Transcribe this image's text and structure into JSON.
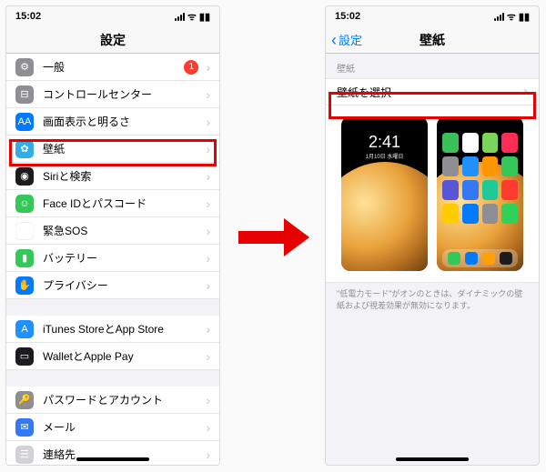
{
  "status": {
    "time": "15:02"
  },
  "left": {
    "title": "設定",
    "groups": [
      [
        {
          "id": "general",
          "label": "一般",
          "color": "c-gray",
          "glyph": "⚙",
          "badge": "1"
        },
        {
          "id": "control",
          "label": "コントロールセンター",
          "color": "c-gray2",
          "glyph": "⊟"
        },
        {
          "id": "display",
          "label": "画面表示と明るさ",
          "color": "c-blue",
          "glyph": "AA"
        },
        {
          "id": "wallpaper",
          "label": "壁紙",
          "color": "c-cyan",
          "glyph": "✿"
        },
        {
          "id": "siri",
          "label": "Siriと検索",
          "color": "c-black",
          "glyph": "◉"
        },
        {
          "id": "faceid",
          "label": "Face IDとパスコード",
          "color": "c-green",
          "glyph": "☺"
        },
        {
          "id": "sos",
          "label": "緊急SOS",
          "color": "c-sos",
          "glyph": "SOS"
        },
        {
          "id": "battery",
          "label": "バッテリー",
          "color": "c-green2",
          "glyph": "▮"
        },
        {
          "id": "privacy",
          "label": "プライバシー",
          "color": "c-blue",
          "glyph": "✋"
        }
      ],
      [
        {
          "id": "appstore",
          "label": "iTunes StoreとApp Store",
          "color": "c-appstore",
          "glyph": "A"
        },
        {
          "id": "wallet",
          "label": "WalletとApple Pay",
          "color": "c-wallet",
          "glyph": "▭"
        }
      ],
      [
        {
          "id": "accounts",
          "label": "パスワードとアカウント",
          "color": "c-key",
          "glyph": "🔑"
        },
        {
          "id": "mail",
          "label": "メール",
          "color": "c-mail",
          "glyph": "✉"
        },
        {
          "id": "contacts",
          "label": "連絡先",
          "color": "c-contacts",
          "glyph": "☰"
        }
      ]
    ]
  },
  "right": {
    "back": "設定",
    "title": "壁紙",
    "section_header": "壁紙",
    "choose": "壁紙を選択",
    "lock_time": "2:41",
    "lock_date": "1月10日 水曜日",
    "footnote": "\"低電力モード\"がオンのときは、ダイナミックの壁紙および視差効果が無効になります。",
    "home_apps": [
      "#3ac159",
      "#fff",
      "#7bd45b",
      "#ff2d55",
      "#8e8e93",
      "#1e90ff",
      "#ff9500",
      "#34c759",
      "#5856d6",
      "#3478f6",
      "#20c997",
      "#ff3b30",
      "#ffcc00",
      "#007aff",
      "#8e8e93",
      "#30d158"
    ],
    "dock_apps": [
      "#34c759",
      "#007aff",
      "#ff9f0a",
      "#1c1c1e"
    ]
  }
}
